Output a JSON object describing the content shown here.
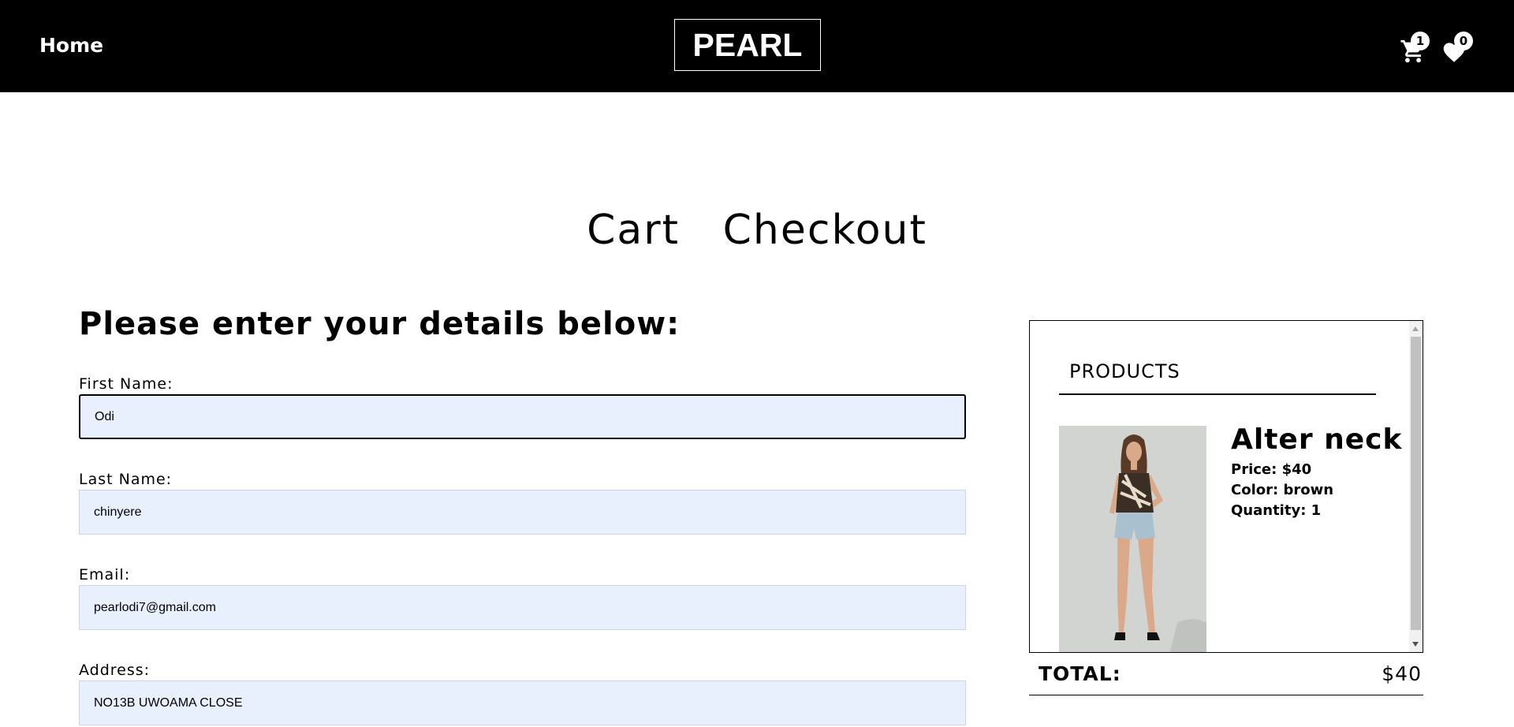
{
  "header": {
    "home_label": "Home",
    "logo_text": "PEARL",
    "cart_count": "1",
    "wishlist_count": "0"
  },
  "tabs": [
    {
      "label": "Cart"
    },
    {
      "label": "Checkout"
    }
  ],
  "form": {
    "heading": "Please enter your details below:",
    "fields": [
      {
        "label": "First Name:",
        "value": "Odi"
      },
      {
        "label": "Last Name:",
        "value": "chinyere"
      },
      {
        "label": "Email:",
        "value": "pearlodi7@gmail.com"
      },
      {
        "label": "Address:",
        "value": "NO13B UWOAMA CLOSE"
      }
    ]
  },
  "summary": {
    "title": "PRODUCTS",
    "product": {
      "name": "Alter neck",
      "price": "Price: $40",
      "color": "Color: brown",
      "quantity": "Quantity: 1"
    },
    "total_label": "TOTAL:",
    "total_value": "$40"
  },
  "colors": {
    "header_bg": "#000000",
    "input_bg": "#e8f0fe"
  }
}
